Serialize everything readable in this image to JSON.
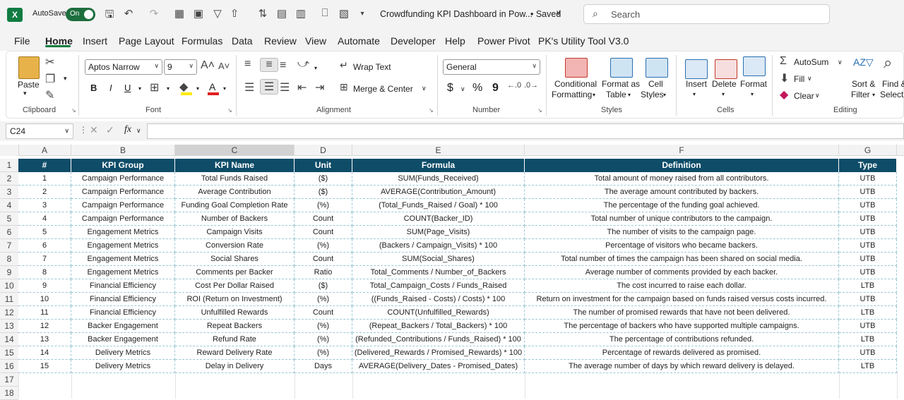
{
  "titlebar": {
    "autosave_label": "AutoSave",
    "autosave_state": "On",
    "doc_title": "Crowdfunding KPI Dashboard in Pow...",
    "saved_label": "• Saved",
    "search_placeholder": "Search",
    "app_icon_letter": "X"
  },
  "menu": {
    "tabs": [
      "File",
      "Home",
      "Insert",
      "Page Layout",
      "Formulas",
      "Data",
      "Review",
      "View",
      "Automate",
      "Developer",
      "Help",
      "Power Pivot",
      "PK's Utility Tool V3.0"
    ],
    "active": "Home"
  },
  "ribbon": {
    "clipboard": {
      "paste": "Paste",
      "group": "Clipboard"
    },
    "font": {
      "name": "Aptos Narrow",
      "size": "9",
      "bold": "B",
      "italic": "I",
      "underline": "U",
      "group": "Font"
    },
    "alignment": {
      "wrap": "Wrap Text",
      "merge": "Merge & Center",
      "group": "Alignment"
    },
    "number": {
      "format": "General",
      "dollar": "$",
      "percent": "%",
      "comma": "9",
      "group": "Number"
    },
    "styles": {
      "cond1": "Conditional",
      "cond2": "Formatting",
      "fmt1": "Format as",
      "fmt2": "Table",
      "cell1": "Cell",
      "cell2": "Styles",
      "group": "Styles"
    },
    "cells": {
      "insert": "Insert",
      "delete": "Delete",
      "format": "Format",
      "group": "Cells"
    },
    "editing": {
      "autosum": "AutoSum",
      "fill": "Fill",
      "clear": "Clear",
      "sort1": "Sort &",
      "sort2": "Filter",
      "find1": "Find &",
      "find2": "Select",
      "group": "Editing"
    }
  },
  "formula_bar": {
    "name_box": "C24",
    "fx": "fx",
    "content": ""
  },
  "columns": [
    "A",
    "B",
    "C",
    "D",
    "E",
    "F",
    "G"
  ],
  "selected_column": "C",
  "rows": [
    "1",
    "2",
    "3",
    "4",
    "5",
    "6",
    "7",
    "8",
    "9",
    "10",
    "11",
    "12",
    "13",
    "14",
    "15",
    "16",
    "17",
    "18"
  ],
  "table": {
    "headers": [
      "#",
      "KPI Group",
      "KPI Name",
      "Unit",
      "Formula",
      "Definition",
      "Type"
    ],
    "rows": [
      [
        "1",
        "Campaign Performance",
        "Total Funds Raised",
        "($)",
        "SUM(Funds_Received)",
        "Total amount of money raised from all contributors.",
        "UTB"
      ],
      [
        "2",
        "Campaign Performance",
        "Average Contribution",
        "($)",
        "AVERAGE(Contribution_Amount)",
        "The average amount contributed by backers.",
        "UTB"
      ],
      [
        "3",
        "Campaign Performance",
        "Funding Goal Completion Rate",
        "(%)",
        "(Total_Funds_Raised / Goal) * 100",
        "The percentage of the funding goal achieved.",
        "UTB"
      ],
      [
        "4",
        "Campaign Performance",
        "Number of Backers",
        "Count",
        "COUNT(Backer_ID)",
        "Total number of unique contributors to the campaign.",
        "UTB"
      ],
      [
        "5",
        "Engagement Metrics",
        "Campaign Visits",
        "Count",
        "SUM(Page_Visits)",
        "The number of visits to the campaign page.",
        "UTB"
      ],
      [
        "6",
        "Engagement Metrics",
        "Conversion Rate",
        "(%)",
        "(Backers / Campaign_Visits) * 100",
        "Percentage of visitors who became backers.",
        "UTB"
      ],
      [
        "7",
        "Engagement Metrics",
        "Social Shares",
        "Count",
        "SUM(Social_Shares)",
        "Total number of times the campaign has been shared on social media.",
        "UTB"
      ],
      [
        "8",
        "Engagement Metrics",
        "Comments per Backer",
        "Ratio",
        "Total_Comments / Number_of_Backers",
        "Average number of comments provided by each backer.",
        "UTB"
      ],
      [
        "9",
        "Financial Efficiency",
        "Cost Per Dollar Raised",
        "($)",
        "Total_Campaign_Costs / Funds_Raised",
        "The cost incurred to raise each dollar.",
        "LTB"
      ],
      [
        "10",
        "Financial Efficiency",
        "ROI (Return on Investment)",
        "(%)",
        "((Funds_Raised - Costs) / Costs) * 100",
        "Return on investment for the campaign based on funds raised versus costs incurred.",
        "UTB"
      ],
      [
        "11",
        "Financial Efficiency",
        "Unfulfilled Rewards",
        "Count",
        "COUNT(Unfulfilled_Rewards)",
        "The number of promised rewards that have not been delivered.",
        "LTB"
      ],
      [
        "12",
        "Backer Engagement",
        "Repeat Backers",
        "(%)",
        "(Repeat_Backers / Total_Backers) * 100",
        "The percentage of backers who have supported multiple campaigns.",
        "UTB"
      ],
      [
        "13",
        "Backer Engagement",
        "Refund Rate",
        "(%)",
        "(Refunded_Contributions / Funds_Raised) * 100",
        "The percentage of contributions refunded.",
        "LTB"
      ],
      [
        "14",
        "Delivery Metrics",
        "Reward Delivery Rate",
        "(%)",
        "(Delivered_Rewards / Promised_Rewards) * 100",
        "Percentage of rewards delivered as promised.",
        "UTB"
      ],
      [
        "15",
        "Delivery Metrics",
        "Delay in Delivery",
        "Days",
        "AVERAGE(Delivery_Dates - Promised_Dates)",
        "The average number of days by which reward delivery is delayed.",
        "LTB"
      ]
    ]
  },
  "colors": {
    "header_bg": "#0e4c68",
    "excel_green": "#107c41"
  }
}
